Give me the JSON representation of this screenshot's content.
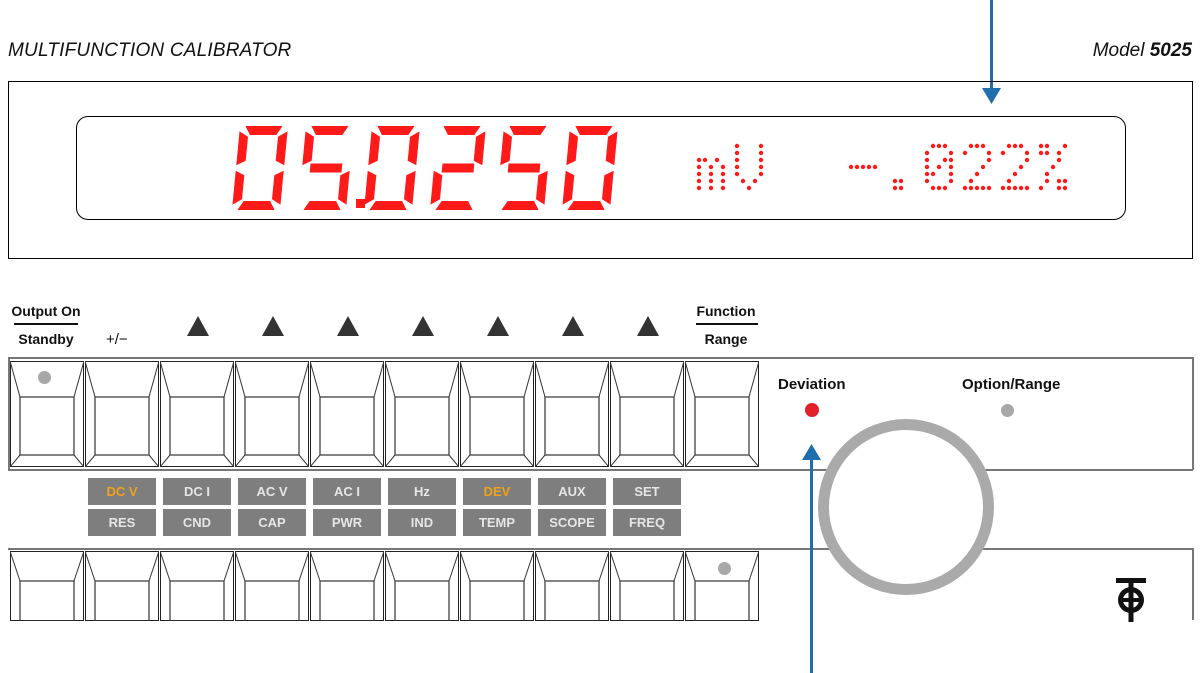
{
  "header": {
    "left_title": "MULTIFUNCTION CALIBRATOR",
    "model_prefix": "Model",
    "model_number": "5025"
  },
  "display": {
    "main_value": "05.0250",
    "unit": "mV",
    "sign": "-",
    "deviation_digits": ".022",
    "percent": "%",
    "color": "#ff1a1a"
  },
  "top_labels": {
    "output_on": "Output On",
    "standby": "Standby",
    "plus_minus": "+/−",
    "function": "Function",
    "range": "Range"
  },
  "function_labels": {
    "upper": [
      "DC V",
      "DC I",
      "AC V",
      "AC I",
      "Hz",
      "DEV",
      "AUX",
      "SET"
    ],
    "lower": [
      "RES",
      "CND",
      "CAP",
      "PWR",
      "IND",
      "TEMP",
      "SCOPE",
      "FREQ"
    ],
    "highlight_color": "#f2a11c"
  },
  "side": {
    "deviation": "Deviation",
    "option_range": "Option/Range"
  },
  "colors": {
    "arrow": "#1f6fae",
    "led_active": "#e3202a",
    "led_idle": "#a8a8a8"
  }
}
